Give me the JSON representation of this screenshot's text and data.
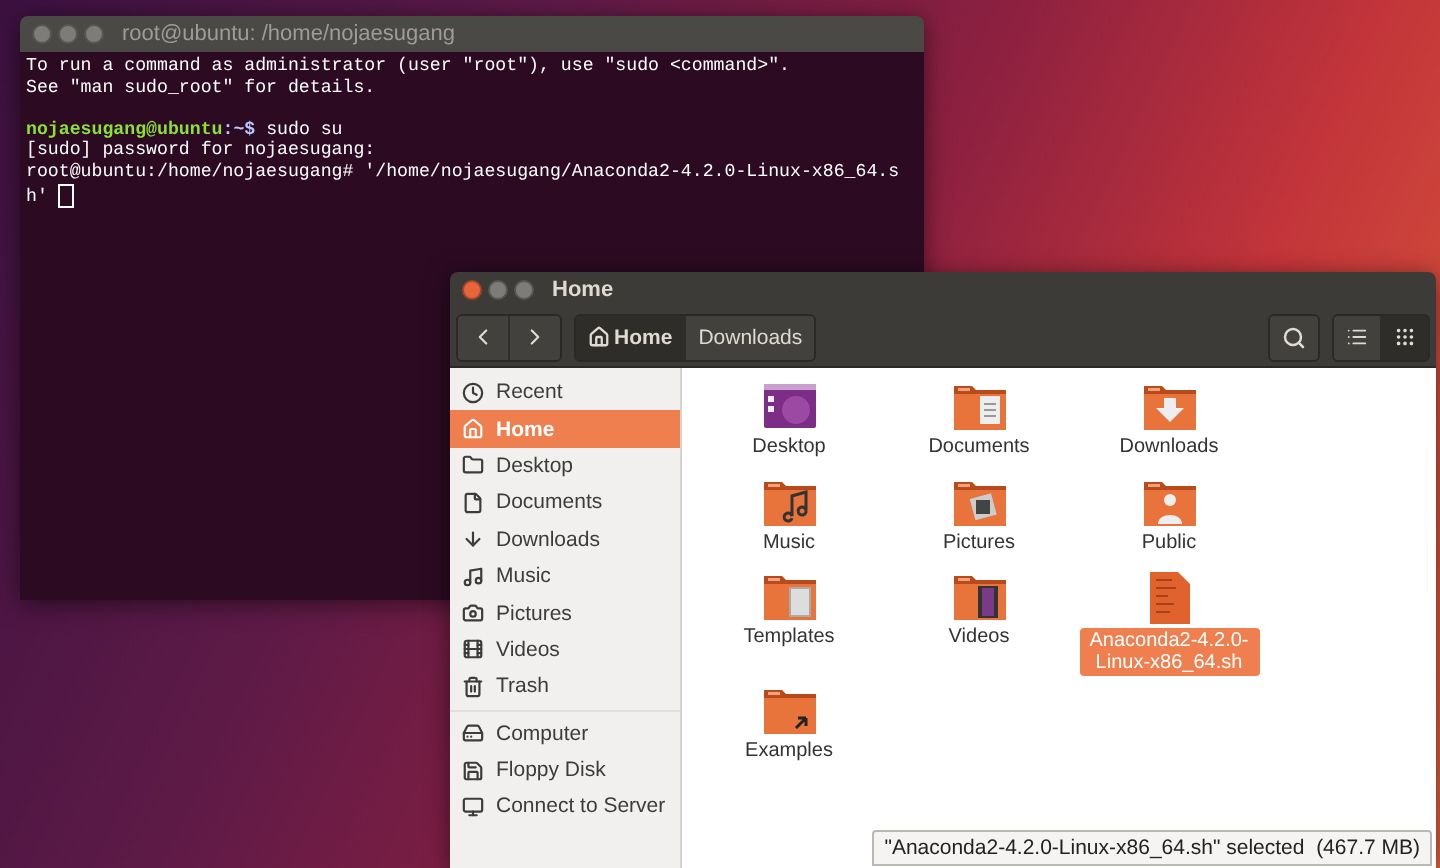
{
  "terminal": {
    "title": "root@ubuntu: /home/nojaesugang",
    "active": false,
    "lines": [
      {
        "kind": "output",
        "text": "To run a command as administrator (user \"root\"), use \"sudo <command>\"."
      },
      {
        "kind": "output",
        "text": "See \"man sudo_root\" for details."
      },
      {
        "kind": "prompt",
        "user": "nojaesugang@ubuntu",
        "path": ":~$",
        "command": " sudo su"
      },
      {
        "kind": "output",
        "text": "[sudo] password for nojaesugang:"
      },
      {
        "kind": "output",
        "text": "root@ubuntu:/home/nojaesugang# '/home/nojaesugang/Anaconda2-4.2.0-Linux-x86_64.s"
      },
      {
        "kind": "cursor",
        "text": "h' "
      }
    ]
  },
  "files": {
    "title": "Home",
    "active": true,
    "path": [
      {
        "label": "Home",
        "selected": true
      },
      {
        "label": "Downloads",
        "selected": false
      }
    ],
    "places": [
      {
        "label": "Recent",
        "selected": false
      },
      {
        "label": "Home",
        "selected": true
      },
      {
        "label": "Desktop",
        "selected": false
      },
      {
        "label": "Documents",
        "selected": false
      },
      {
        "label": "Downloads",
        "selected": false
      },
      {
        "label": "Music",
        "selected": false
      },
      {
        "label": "Pictures",
        "selected": false
      },
      {
        "label": "Videos",
        "selected": false
      },
      {
        "label": "Trash",
        "selected": false
      }
    ],
    "devices": [
      {
        "label": "Computer",
        "selected": false
      },
      {
        "label": "Floppy Disk",
        "selected": false
      },
      {
        "label": "Connect to Server",
        "selected": false
      }
    ],
    "items": [
      {
        "label": "Desktop",
        "kind": "desktop",
        "selected": false
      },
      {
        "label": "Documents",
        "kind": "folder",
        "selected": false
      },
      {
        "label": "Downloads",
        "kind": "folder",
        "selected": false
      },
      {
        "label": "Music",
        "kind": "folder",
        "selected": false
      },
      {
        "label": "Pictures",
        "kind": "folder",
        "selected": false
      },
      {
        "label": "Public",
        "kind": "folder",
        "selected": false
      },
      {
        "label": "Templates",
        "kind": "folder",
        "selected": false
      },
      {
        "label": "Videos",
        "kind": "folder",
        "selected": false
      },
      {
        "label": "Anaconda2-4.2.0-Linux-x86_64.sh",
        "kind": "script",
        "selected": true
      },
      {
        "label": "Examples",
        "kind": "folder",
        "selected": false
      }
    ],
    "status": "\"Anaconda2-4.2.0-Linux-x86_64.sh\" selected  (467.7 MB)"
  }
}
